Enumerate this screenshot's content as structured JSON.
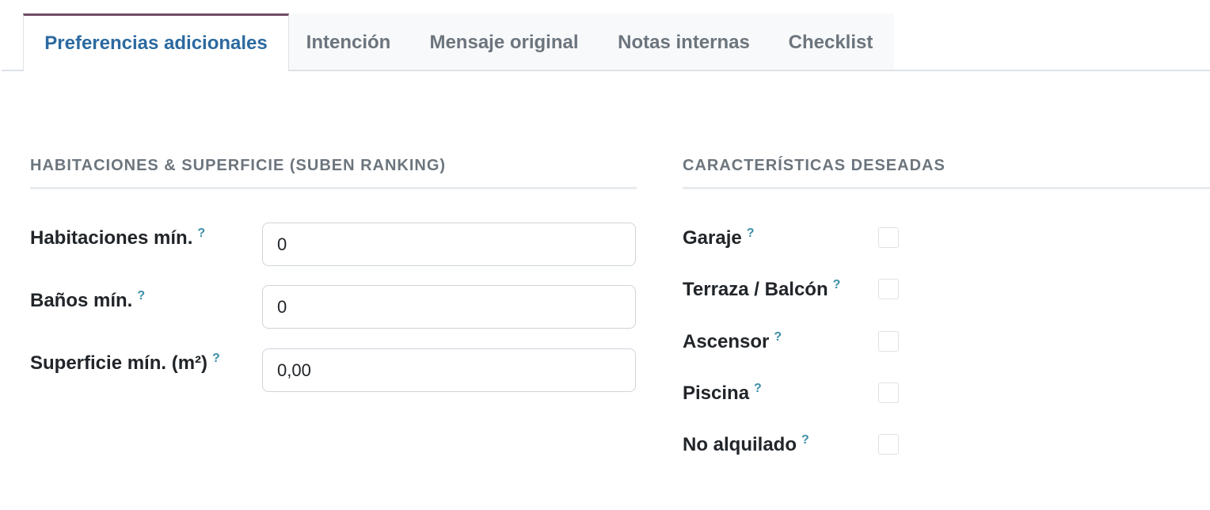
{
  "tabs": [
    {
      "label": "Preferencias adicionales",
      "active": true
    },
    {
      "label": "Intención",
      "active": false
    },
    {
      "label": "Mensaje original",
      "active": false
    },
    {
      "label": "Notas internas",
      "active": false
    },
    {
      "label": "Checklist",
      "active": false
    }
  ],
  "rooms_section": {
    "title": "HABITACIONES & SUPERFICIE (SUBEN RANKING)",
    "fields": [
      {
        "label": "Habitaciones mín.",
        "value": "0"
      },
      {
        "label": "Baños mín.",
        "value": "0"
      },
      {
        "label": "Superficie mín. (m²)",
        "value": "0,00"
      }
    ]
  },
  "features_section": {
    "title": "CARACTERÍSTICAS DESEADAS",
    "items": [
      {
        "label": "Garaje",
        "checked": false
      },
      {
        "label": "Terraza / Balcón",
        "checked": false
      },
      {
        "label": "Ascensor",
        "checked": false
      },
      {
        "label": "Piscina",
        "checked": false
      },
      {
        "label": "No alquilado",
        "checked": false
      }
    ]
  },
  "help_marker": "?",
  "colors": {
    "active_tab_text": "#2c6aa0",
    "active_tab_top_border": "#714b67",
    "help_marker": "#3d8fa8",
    "inactive_tab_text": "#6c757d"
  }
}
